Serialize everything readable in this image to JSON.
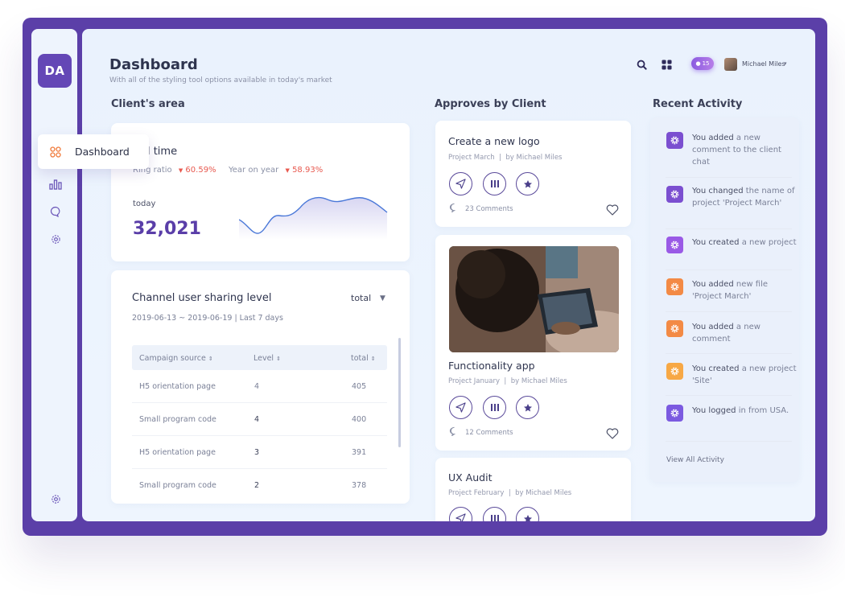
{
  "brand": {
    "initials": "DA"
  },
  "nav": {
    "active_label": "Dashboard"
  },
  "header": {
    "title": "Dashboard",
    "subtitle": "With all of the styling tool options available in today's market",
    "notification_count": "15",
    "user_name": "Michael Miles"
  },
  "clients_area": {
    "section_title": "Client's area",
    "real_time": {
      "title_visible": "al time",
      "ring_ratio_label": "Ring ratio",
      "ring_ratio_value": "60.59%",
      "yoy_label": "Year on year",
      "yoy_value": "58.93%",
      "today_label": "today",
      "today_value": "32,021"
    },
    "channel": {
      "title": "Channel user sharing level",
      "date_range": "2019-06-13 ~ 2019-06-19 | Last 7 days",
      "select_value": "total",
      "columns": [
        "Campaign source",
        "Level",
        "total"
      ],
      "rows": [
        {
          "source": "H5 orientation page",
          "level": "4",
          "total": "405"
        },
        {
          "source": "Small program code",
          "level": "4",
          "total": "400"
        },
        {
          "source": "H5 orientation page",
          "level": "3",
          "total": "391"
        },
        {
          "source": "Small program code",
          "level": "2",
          "total": "378"
        }
      ]
    }
  },
  "approves": {
    "section_title": "Approves by Client",
    "items": [
      {
        "title": "Create a new logo",
        "project": "Project March",
        "sep": "|",
        "author": "by Michael Miles",
        "comments": "23 Comments"
      },
      {
        "title": "Functionality app",
        "project": "Project January",
        "sep": "|",
        "author": "by Michael Miles",
        "comments": "12 Comments"
      },
      {
        "title": "UX Audit",
        "project": "Project February",
        "sep": "|",
        "author": "by Michael Miles"
      }
    ]
  },
  "activity": {
    "section_title": "Recent Activity",
    "items": [
      {
        "lead": "You added",
        "rest": " a new comment to the client chat",
        "color": "#7b4fd0"
      },
      {
        "lead": "You changed",
        "rest": " the name of project 'Project March'",
        "color": "#7b4fd0"
      },
      {
        "lead": "You created",
        "rest": " a new project",
        "color": "#9a5ae6"
      },
      {
        "lead": "You added",
        "rest": " new file 'Project March'",
        "color": "#f38a45"
      },
      {
        "lead": "You added",
        "rest": " a new comment",
        "color": "#f38a45"
      },
      {
        "lead": "You created",
        "rest": " a new project 'Site'",
        "color": "#f7a845"
      },
      {
        "lead": "You logged",
        "rest": " in from USA.",
        "color": "#7b5ae0"
      }
    ],
    "view_all": "View All Activity"
  },
  "colors": {
    "primary": "#5b3fa8",
    "accent_red": "#e8594f",
    "line_blue": "#4a78d8"
  }
}
